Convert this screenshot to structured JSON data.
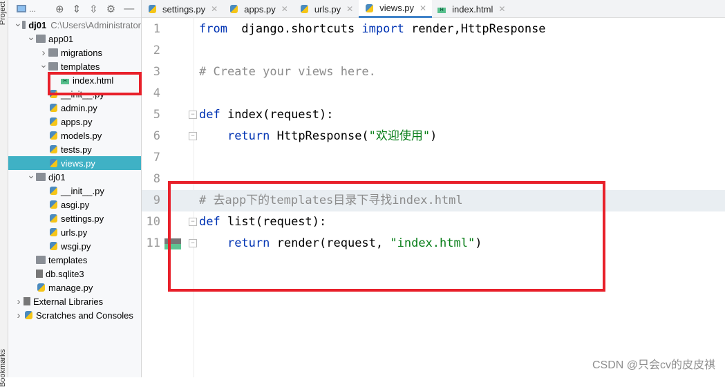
{
  "sidebar": {
    "project_label": "Project",
    "bookmarks_label": "Bookmarks",
    "toolbar_title": "..."
  },
  "tree": [
    {
      "label": "dj01",
      "path": "C:\\Users\\Administrator",
      "level": 0,
      "type": "folder",
      "expanded": true,
      "bold": true
    },
    {
      "label": "app01",
      "level": 1,
      "type": "folder",
      "expanded": true
    },
    {
      "label": "migrations",
      "level": 2,
      "type": "folder",
      "expanded": false
    },
    {
      "label": "templates",
      "level": 2,
      "type": "folder",
      "expanded": true
    },
    {
      "label": "index.html",
      "level": 3,
      "type": "html"
    },
    {
      "label": "__init__.py",
      "level": 2,
      "type": "py"
    },
    {
      "label": "admin.py",
      "level": 2,
      "type": "py"
    },
    {
      "label": "apps.py",
      "level": 2,
      "type": "py"
    },
    {
      "label": "models.py",
      "level": 2,
      "type": "py"
    },
    {
      "label": "tests.py",
      "level": 2,
      "type": "py"
    },
    {
      "label": "views.py",
      "level": 2,
      "type": "py",
      "selected": true
    },
    {
      "label": "dj01",
      "level": 1,
      "type": "folder",
      "expanded": true
    },
    {
      "label": "__init__.py",
      "level": 2,
      "type": "py"
    },
    {
      "label": "asgi.py",
      "level": 2,
      "type": "py"
    },
    {
      "label": "settings.py",
      "level": 2,
      "type": "py"
    },
    {
      "label": "urls.py",
      "level": 2,
      "type": "py"
    },
    {
      "label": "wsgi.py",
      "level": 2,
      "type": "py"
    },
    {
      "label": "templates",
      "level": 1,
      "type": "folder"
    },
    {
      "label": "db.sqlite3",
      "level": 1,
      "type": "file"
    },
    {
      "label": "manage.py",
      "level": 1,
      "type": "py"
    },
    {
      "label": "External Libraries",
      "level": 0,
      "type": "lib",
      "expanded": false
    },
    {
      "label": "Scratches and Consoles",
      "level": 0,
      "type": "scratch",
      "expanded": false
    }
  ],
  "tabs": [
    {
      "label": "settings.py",
      "type": "py"
    },
    {
      "label": "apps.py",
      "type": "py"
    },
    {
      "label": "urls.py",
      "type": "py"
    },
    {
      "label": "views.py",
      "type": "py",
      "active": true
    },
    {
      "label": "index.html",
      "type": "html"
    }
  ],
  "code": [
    {
      "n": "1",
      "tokens": [
        [
          "kw",
          "from"
        ],
        [
          "",
          "  django.shortcuts "
        ],
        [
          "kw",
          "import"
        ],
        [
          "",
          " render,HttpResponse"
        ]
      ]
    },
    {
      "n": "2",
      "tokens": []
    },
    {
      "n": "3",
      "tokens": [
        [
          "cm",
          "# Create your views here."
        ]
      ]
    },
    {
      "n": "4",
      "tokens": []
    },
    {
      "n": "5",
      "tokens": [
        [
          "kw",
          "def"
        ],
        [
          "",
          " index(request):"
        ]
      ]
    },
    {
      "n": "6",
      "tokens": [
        [
          "",
          "    "
        ],
        [
          "kw",
          "return"
        ],
        [
          "",
          " HttpResponse("
        ],
        [
          "st",
          "\"欢迎使用\""
        ],
        [
          "",
          ")"
        ]
      ]
    },
    {
      "n": "7",
      "tokens": []
    },
    {
      "n": "8",
      "tokens": []
    },
    {
      "n": "9",
      "tokens": [
        [
          "cm",
          "# 去app下的templates目录下寻找index.html"
        ]
      ],
      "highlight": true
    },
    {
      "n": "10",
      "tokens": [
        [
          "kw",
          "def"
        ],
        [
          "",
          " list(request):"
        ]
      ]
    },
    {
      "n": "11",
      "tokens": [
        [
          "",
          "    "
        ],
        [
          "kw",
          "return"
        ],
        [
          "",
          " render(request, "
        ],
        [
          "st",
          "\"index.html\""
        ],
        [
          "",
          ")"
        ]
      ]
    }
  ],
  "watermark": "CSDN @只会cv的皮皮祺",
  "colors": {
    "selection": "#3fb1c5",
    "annotation": "#e8202a",
    "keyword": "#0033b3",
    "string": "#067d17",
    "comment": "#8c8c8c"
  }
}
